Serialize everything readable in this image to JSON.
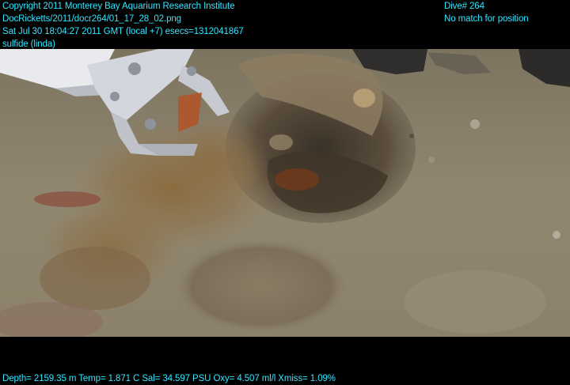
{
  "overlay": {
    "left_lines": [
      "Copyright 2011 Monterey Bay Aquarium Research Institute",
      "DocRicketts/2011/docr264/01_17_28_02.png",
      "Sat Jul 30 18:04:27 2011 GMT (local +7)  esecs=1312041867",
      "sulfide (linda)"
    ],
    "right_lines": [
      "Dive# 264",
      "No match for position"
    ],
    "bottom_line": "Depth= 2159.35 m  Temp= 1.871 C  Sal= 34.597 PSU  Oxy= 4.507 ml/l  Xmiss= 1.09%"
  },
  "colors": {
    "overlay_text": "#33e6ff",
    "background": "#000000",
    "sediment": "#8a7f66"
  }
}
